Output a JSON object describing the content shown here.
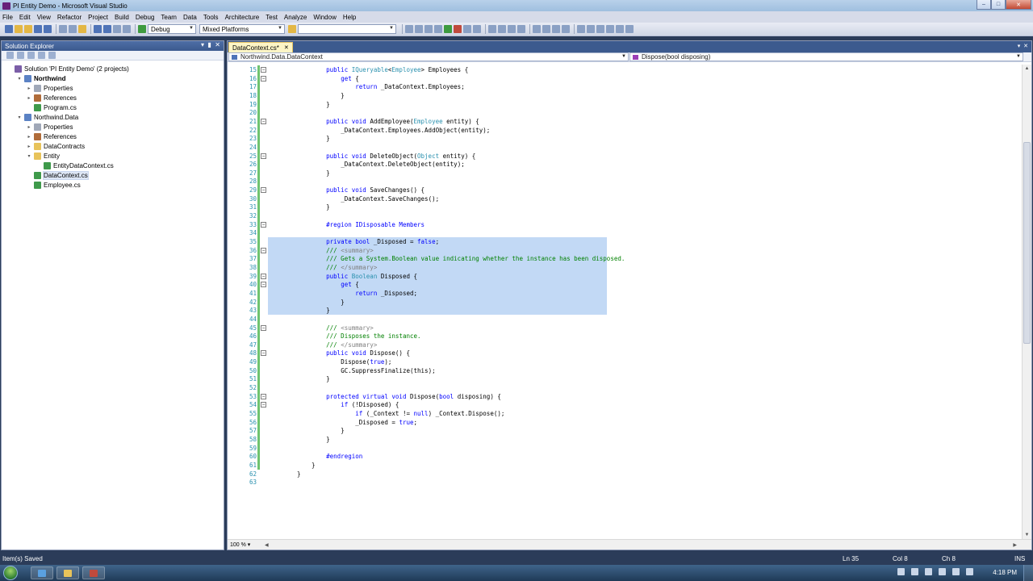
{
  "window": {
    "title": "PI Entity Demo - Microsoft Visual Studio"
  },
  "menu": [
    "File",
    "Edit",
    "View",
    "Refactor",
    "Project",
    "Build",
    "Debug",
    "Team",
    "Data",
    "Tools",
    "Architecture",
    "Test",
    "Analyze",
    "Window",
    "Help"
  ],
  "toolbar": {
    "configuration": "Debug",
    "platform": "Mixed Platforms",
    "find_value": ""
  },
  "solution_explorer": {
    "title": "Solution Explorer",
    "items": [
      {
        "label": "Solution 'PI Entity Demo' (2 projects)",
        "icon": "solution-icon",
        "level": 0,
        "expander": ""
      },
      {
        "label": "Northwind",
        "icon": "project-icon",
        "level": 1,
        "expander": "▾",
        "bold": true
      },
      {
        "label": "Properties",
        "icon": "properties-icon",
        "level": 2,
        "expander": "▸"
      },
      {
        "label": "References",
        "icon": "references-icon",
        "level": 2,
        "expander": "▸"
      },
      {
        "label": "Program.cs",
        "icon": "cs-file-icon",
        "level": 2,
        "expander": ""
      },
      {
        "label": "Northwind.Data",
        "icon": "project-icon",
        "level": 1,
        "expander": "▾"
      },
      {
        "label": "Properties",
        "icon": "properties-icon",
        "level": 2,
        "expander": "▸"
      },
      {
        "label": "References",
        "icon": "references-icon",
        "level": 2,
        "expander": "▸"
      },
      {
        "label": "DataContracts",
        "icon": "folder-icon",
        "level": 2,
        "expander": "▸"
      },
      {
        "label": "Entity",
        "icon": "folder-icon",
        "level": 2,
        "expander": "▾"
      },
      {
        "label": "EntityDataContext.cs",
        "icon": "cs-file-icon",
        "level": 3,
        "expander": ""
      },
      {
        "label": "DataContext.cs",
        "icon": "cs-file-icon",
        "level": 2,
        "expander": "",
        "selected": true
      },
      {
        "label": "Employee.cs",
        "icon": "cs-file-icon",
        "level": 2,
        "expander": ""
      }
    ]
  },
  "editor": {
    "tab": "DataContext.cs*",
    "nav_type": "Northwind.Data.DataContext",
    "nav_member": "Dispose(bool disposing)",
    "zoom": "100 %",
    "lines": [
      {
        "n": "15",
        "t": "        public IQueryable<Employee> Employees {"
      },
      {
        "n": "16",
        "t": "            get {"
      },
      {
        "n": "17",
        "t": "                return _DataContext.Employees;"
      },
      {
        "n": "18",
        "t": "            }"
      },
      {
        "n": "19",
        "t": "        }"
      },
      {
        "n": "20",
        "t": ""
      },
      {
        "n": "21",
        "t": "        public void AddEmployee(Employee entity) {"
      },
      {
        "n": "22",
        "t": "            _DataContext.Employees.AddObject(entity);"
      },
      {
        "n": "23",
        "t": "        }"
      },
      {
        "n": "24",
        "t": ""
      },
      {
        "n": "25",
        "t": "        public void DeleteObject(Object entity) {"
      },
      {
        "n": "26",
        "t": "            _DataContext.DeleteObject(entity);"
      },
      {
        "n": "27",
        "t": "        }"
      },
      {
        "n": "28",
        "t": ""
      },
      {
        "n": "29",
        "t": "        public void SaveChanges() {"
      },
      {
        "n": "30",
        "t": "            _DataContext.SaveChanges();"
      },
      {
        "n": "31",
        "t": "        }"
      },
      {
        "n": "32",
        "t": ""
      },
      {
        "n": "33",
        "t": "        #region IDisposable Members"
      },
      {
        "n": "34",
        "t": ""
      },
      {
        "n": "35",
        "t": "        private bool _Disposed = false;"
      },
      {
        "n": "36",
        "t": "        /// <summary>"
      },
      {
        "n": "37",
        "t": "        /// Gets a System.Boolean value indicating whether the instance has been disposed."
      },
      {
        "n": "38",
        "t": "        /// </summary>"
      },
      {
        "n": "39",
        "t": "        public Boolean Disposed {"
      },
      {
        "n": "40",
        "t": "            get {"
      },
      {
        "n": "41",
        "t": "                return _Disposed;"
      },
      {
        "n": "42",
        "t": "            }"
      },
      {
        "n": "43",
        "t": "        }"
      },
      {
        "n": "44",
        "t": ""
      },
      {
        "n": "45",
        "t": "        /// <summary>"
      },
      {
        "n": "46",
        "t": "        /// Disposes the instance."
      },
      {
        "n": "47",
        "t": "        /// </summary>"
      },
      {
        "n": "48",
        "t": "        public void Dispose() {"
      },
      {
        "n": "49",
        "t": "            Dispose(true);"
      },
      {
        "n": "50",
        "t": "            GC.SuppressFinalize(this);"
      },
      {
        "n": "51",
        "t": "        }"
      },
      {
        "n": "52",
        "t": ""
      },
      {
        "n": "53",
        "t": "        protected virtual void Dispose(bool disposing) {"
      },
      {
        "n": "54",
        "t": "            if (!Disposed) {"
      },
      {
        "n": "55",
        "t": "                if (_Context != null) _Context.Dispose();"
      },
      {
        "n": "56",
        "t": "                _Disposed = true;"
      },
      {
        "n": "57",
        "t": "            }"
      },
      {
        "n": "58",
        "t": "        }"
      },
      {
        "n": "59",
        "t": ""
      },
      {
        "n": "60",
        "t": "        #endregion"
      },
      {
        "n": "61",
        "t": "    }"
      },
      {
        "n": "62",
        "t": "}"
      },
      {
        "n": "63",
        "t": ""
      }
    ],
    "fold_lines": [
      "15",
      "16",
      "21",
      "25",
      "29",
      "33",
      "36",
      "39",
      "40",
      "45",
      "48",
      "53",
      "54"
    ],
    "selected_lines": [
      "35",
      "36",
      "37",
      "38",
      "39",
      "40",
      "41",
      "42",
      "43"
    ]
  },
  "status": {
    "message": "Item(s) Saved",
    "ln": "Ln 35",
    "col": "Col 8",
    "ch": "Ch 8",
    "mode": "INS"
  },
  "taskbar": {
    "clock": "4:18 PM"
  }
}
